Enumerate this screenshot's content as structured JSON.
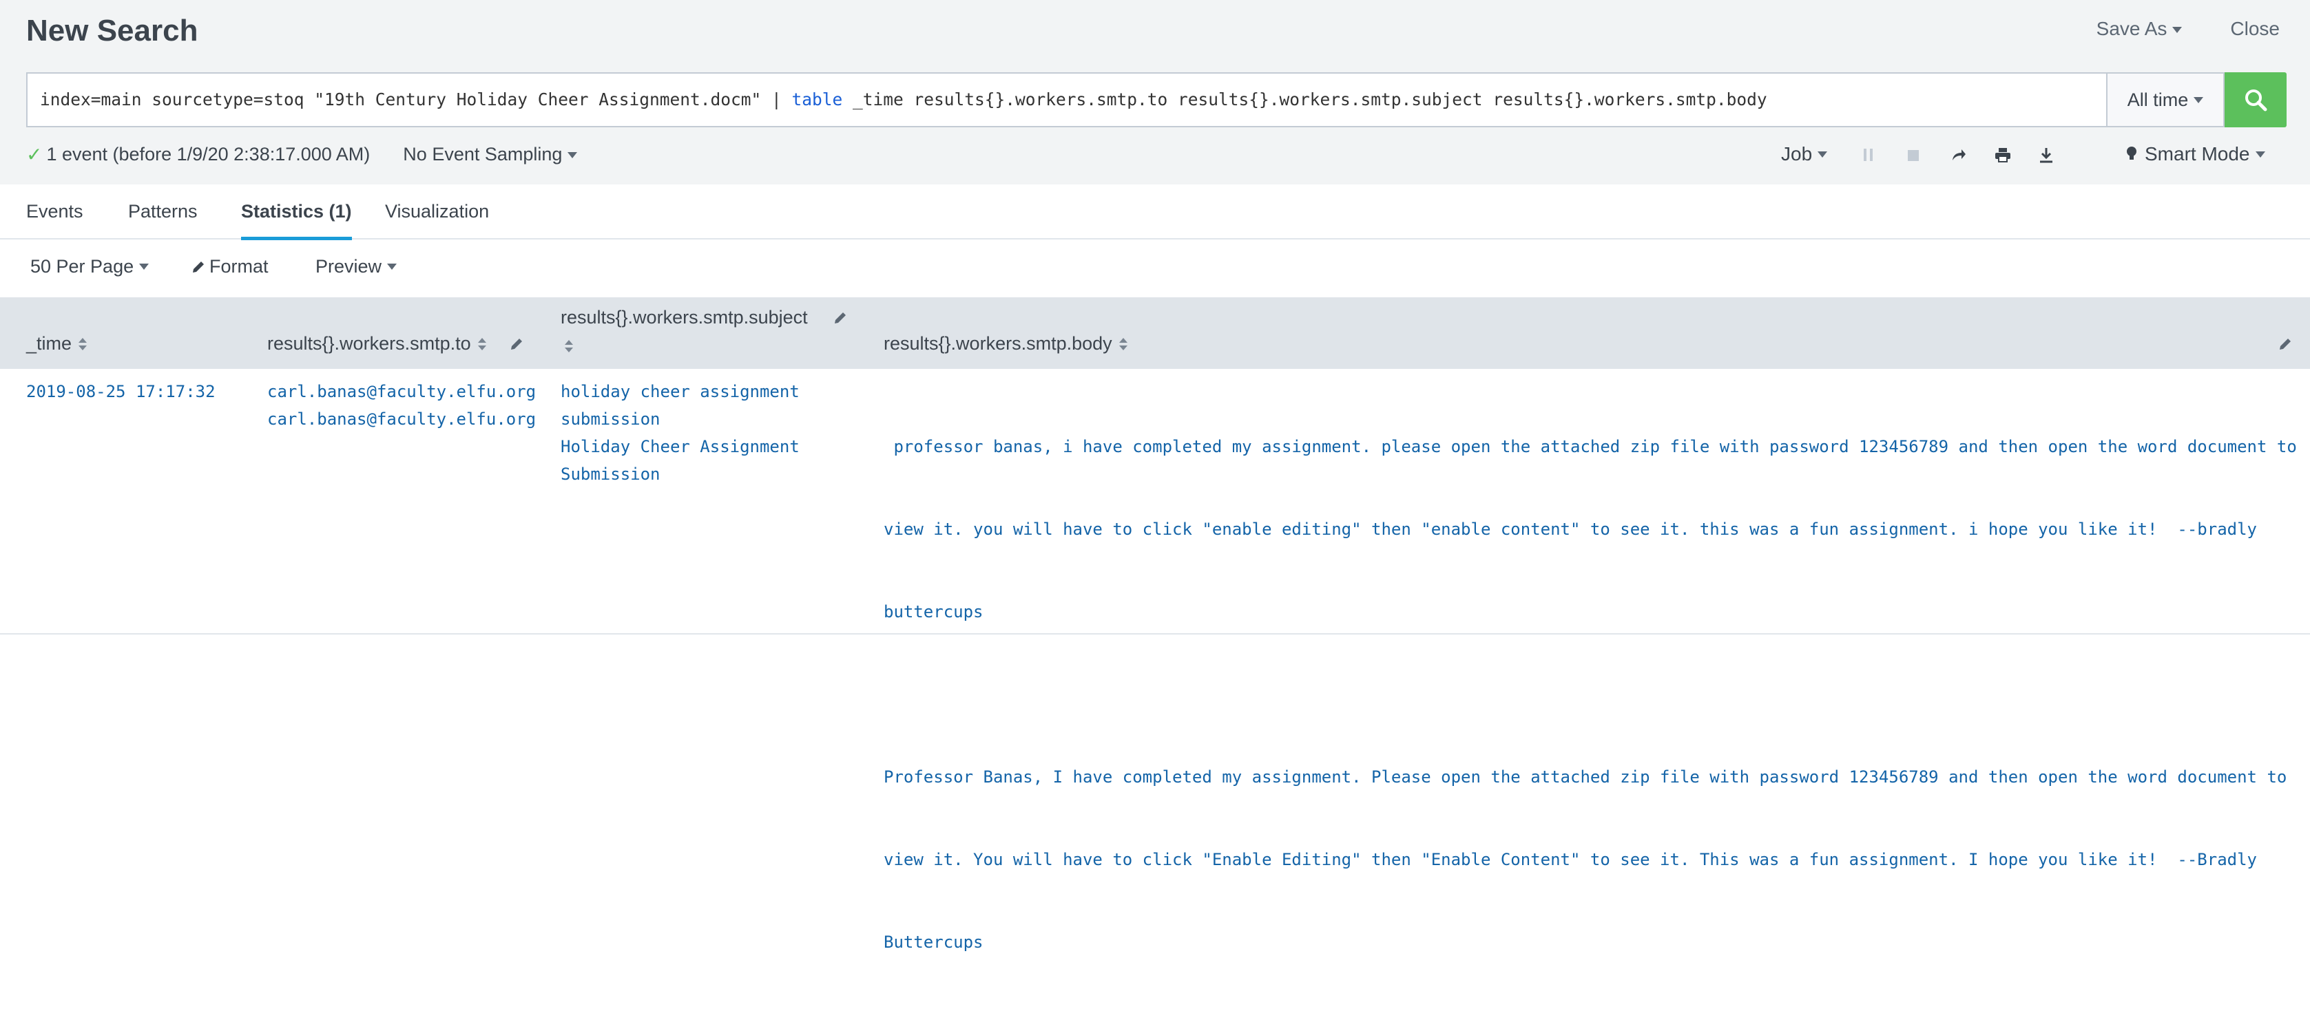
{
  "header": {
    "title": "New Search",
    "save_as": "Save As",
    "close": "Close"
  },
  "search": {
    "query_prefix": "index=main sourcetype=stoq \"19th Century Holiday Cheer Assignment.docm\" | ",
    "query_command": "table",
    "query_suffix": " _time results{}.workers.smtp.to results{}.workers.smtp.subject results{}.workers.smtp.body",
    "time_range": "All time"
  },
  "status": {
    "events": "1 event (before 1/9/20 2:38:17.000 AM)",
    "sampling": "No Event Sampling"
  },
  "jobtools": {
    "job": "Job",
    "mode": "Smart Mode"
  },
  "tabs": [
    {
      "label": "Events"
    },
    {
      "label": "Patterns"
    },
    {
      "label": "Statistics (1)"
    },
    {
      "label": "Visualization"
    }
  ],
  "toolbar": {
    "per_page": "50 Per Page",
    "format": "Format",
    "preview": "Preview"
  },
  "table": {
    "columns": [
      {
        "label": "_time"
      },
      {
        "label": "results{}.workers.smtp.to"
      },
      {
        "label": "results{}.workers.smtp.subject"
      },
      {
        "label": "results{}.workers.smtp.body"
      }
    ],
    "row": {
      "time": "2019-08-25 17:17:32",
      "to": [
        "carl.banas@faculty.elfu.org",
        "carl.banas@faculty.elfu.org"
      ],
      "subject": [
        "holiday cheer assignment",
        "submission",
        "Holiday Cheer Assignment",
        "Submission"
      ],
      "body_1": [
        " professor banas, i have completed my assignment. please open the attached zip file with password 123456789 and then open the word document to",
        "view it. you will have to click \"enable editing\" then \"enable content\" to see it. this was a fun assignment. i hope you like it!  --bradly",
        "buttercups"
      ],
      "body_2": [
        "Professor Banas, I have completed my assignment. Please open the attached zip file with password 123456789 and then open the word document to",
        "view it. You will have to click \"Enable Editing\" then \"Enable Content\" to see it. This was a fun assignment. I hope you like it!  --Bradly",
        "Buttercups"
      ]
    }
  },
  "colors": {
    "accent": "#1a9cd8",
    "go_button": "#5cc05c",
    "cell_text": "#1464a8",
    "header_bg": "#dfe4e9"
  },
  "icons": {
    "search": "search-icon",
    "pause": "pause-icon",
    "stop": "stop-icon",
    "share": "share-icon",
    "print": "print-icon",
    "export": "export-icon",
    "mode": "lightbulb-icon",
    "pencil": "pencil-icon"
  }
}
